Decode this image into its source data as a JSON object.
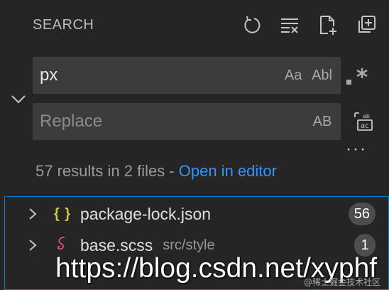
{
  "header": {
    "title": "SEARCH",
    "icons": [
      "refresh-icon",
      "clear-results-icon",
      "new-search-editor-icon",
      "collapse-all-icon"
    ]
  },
  "search": {
    "value": "px",
    "match_case_label": "Aa",
    "whole_word_label": "Abl",
    "regex_icon": "regex-icon"
  },
  "replace": {
    "placeholder": "Replace",
    "preserve_case_label": "AB",
    "replace_all_icon": "replace-all-icon"
  },
  "summary": {
    "text": "57 results in 2 files - ",
    "link": "Open in editor"
  },
  "results": [
    {
      "icon": "{ }",
      "name": "package-lock.json",
      "path": "",
      "count": "56"
    },
    {
      "icon": "sass-icon",
      "name": "base.scss",
      "path": "src/style",
      "count": "1"
    }
  ],
  "watermark": {
    "url": "https://blog.csdn.net/xyphf",
    "site": "@稀土掘金技术社区"
  },
  "colors": {
    "link": "#3794ff",
    "focus_border": "#007fd4",
    "json_icon": "#cbcb41",
    "sass_icon": "#f55385"
  }
}
